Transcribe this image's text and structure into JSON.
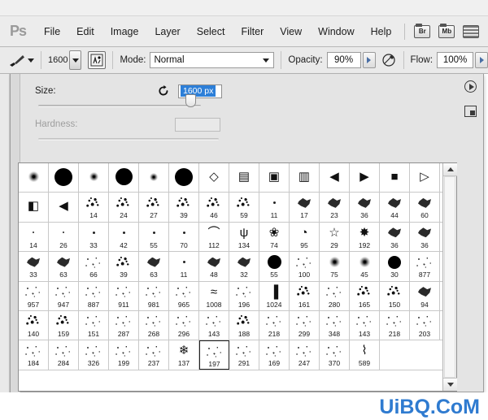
{
  "app": {
    "name": "Ps",
    "logo_text": "Ps"
  },
  "menubar": {
    "items": [
      {
        "label": "File"
      },
      {
        "label": "Edit"
      },
      {
        "label": "Image"
      },
      {
        "label": "Layer"
      },
      {
        "label": "Select"
      },
      {
        "label": "Filter"
      },
      {
        "label": "View"
      },
      {
        "label": "Window"
      },
      {
        "label": "Help"
      }
    ],
    "buttons": [
      {
        "label": "Br",
        "name": "bridge-button"
      },
      {
        "label": "Mb",
        "name": "mini-bridge-button"
      },
      {
        "label": "",
        "name": "arrange-documents-button"
      }
    ]
  },
  "options_bar": {
    "brush_size_value": "1600",
    "mode_label": "Mode:",
    "mode_value": "Normal",
    "opacity_label": "Opacity:",
    "opacity_value": "90%",
    "flow_label": "Flow:",
    "flow_value": "100%"
  },
  "picker": {
    "size_label": "Size:",
    "size_value": "1600 px",
    "hardness_label": "Hardness:",
    "hardness_value": ""
  },
  "brush_grid": {
    "selected_label": "197",
    "rows": [
      [
        {
          "label": "",
          "shape": "soft",
          "size": 13
        },
        {
          "label": "",
          "shape": "hard",
          "size": 22
        },
        {
          "label": "",
          "shape": "soft",
          "size": 11
        },
        {
          "label": "",
          "shape": "hard",
          "size": 21
        },
        {
          "label": "",
          "shape": "soft",
          "size": 10
        },
        {
          "label": "",
          "shape": "hard",
          "size": 22
        },
        {
          "label": "",
          "shape": "glyph",
          "glyph": "◇"
        },
        {
          "label": "",
          "shape": "glyph",
          "glyph": "▤"
        },
        {
          "label": "",
          "shape": "glyph",
          "glyph": "▣"
        },
        {
          "label": "",
          "shape": "glyph",
          "glyph": "▥"
        },
        {
          "label": "",
          "shape": "glyph",
          "glyph": "◀"
        },
        {
          "label": "",
          "shape": "glyph",
          "glyph": "▶"
        },
        {
          "label": "",
          "shape": "glyph",
          "glyph": "■"
        },
        {
          "label": "",
          "shape": "glyph",
          "glyph": "▷"
        }
      ],
      [
        {
          "label": "",
          "shape": "glyph",
          "glyph": "◧"
        },
        {
          "label": "",
          "shape": "glyph",
          "glyph": "◀"
        },
        {
          "label": "14",
          "shape": "spatter"
        },
        {
          "label": "24",
          "shape": "spatter"
        },
        {
          "label": "27",
          "shape": "spatter"
        },
        {
          "label": "39",
          "shape": "spatter"
        },
        {
          "label": "46",
          "shape": "spatter"
        },
        {
          "label": "59",
          "shape": "spatter"
        },
        {
          "label": "11",
          "shape": "dot"
        },
        {
          "label": "17",
          "shape": "chalk"
        },
        {
          "label": "23",
          "shape": "chalk"
        },
        {
          "label": "36",
          "shape": "chalk"
        },
        {
          "label": "44",
          "shape": "chalk"
        },
        {
          "label": "60",
          "shape": "chalk"
        }
      ],
      [
        {
          "label": "14",
          "shape": "dot",
          "size": 2
        },
        {
          "label": "26",
          "shape": "dot",
          "size": 2
        },
        {
          "label": "33",
          "shape": "dot",
          "size": 3
        },
        {
          "label": "42",
          "shape": "dot",
          "size": 3
        },
        {
          "label": "55",
          "shape": "dot",
          "size": 3
        },
        {
          "label": "70",
          "shape": "dot",
          "size": 3
        },
        {
          "label": "112",
          "shape": "glyph",
          "glyph": "⌒"
        },
        {
          "label": "134",
          "shape": "glyph",
          "glyph": "ψ"
        },
        {
          "label": "74",
          "shape": "glyph",
          "glyph": "❀"
        },
        {
          "label": "95",
          "shape": "glyph",
          "glyph": "◔"
        },
        {
          "label": "29",
          "shape": "glyph",
          "glyph": "☆"
        },
        {
          "label": "192",
          "shape": "glyph",
          "glyph": "✸"
        },
        {
          "label": "36",
          "shape": "chalk"
        },
        {
          "label": "36",
          "shape": "chalk"
        }
      ],
      [
        {
          "label": "33",
          "shape": "chalk"
        },
        {
          "label": "63",
          "shape": "chalk"
        },
        {
          "label": "66",
          "shape": "fine"
        },
        {
          "label": "39",
          "shape": "spatter"
        },
        {
          "label": "63",
          "shape": "chalk"
        },
        {
          "label": "11",
          "shape": "dot",
          "size": 3
        },
        {
          "label": "48",
          "shape": "chalk"
        },
        {
          "label": "32",
          "shape": "chalk"
        },
        {
          "label": "55",
          "shape": "hard",
          "size": 17
        },
        {
          "label": "100",
          "shape": "fine"
        },
        {
          "label": "75",
          "shape": "soft",
          "size": 13
        },
        {
          "label": "45",
          "shape": "soft",
          "size": 13
        },
        {
          "label": "30",
          "shape": "hard",
          "size": 16
        },
        {
          "label": "877",
          "shape": "fine"
        }
      ],
      [
        {
          "label": "957",
          "shape": "fine"
        },
        {
          "label": "947",
          "shape": "fine"
        },
        {
          "label": "887",
          "shape": "fine"
        },
        {
          "label": "911",
          "shape": "fine"
        },
        {
          "label": "981",
          "shape": "fine"
        },
        {
          "label": "965",
          "shape": "fine"
        },
        {
          "label": "1008",
          "shape": "glyph",
          "glyph": "≈"
        },
        {
          "label": "196",
          "shape": "fine"
        },
        {
          "label": "1024",
          "shape": "glyph",
          "glyph": "▐"
        },
        {
          "label": "161",
          "shape": "spatter"
        },
        {
          "label": "280",
          "shape": "fine"
        },
        {
          "label": "165",
          "shape": "spatter"
        },
        {
          "label": "150",
          "shape": "spatter"
        },
        {
          "label": "94",
          "shape": "chalk"
        }
      ],
      [
        {
          "label": "140",
          "shape": "spatter"
        },
        {
          "label": "159",
          "shape": "spatter"
        },
        {
          "label": "151",
          "shape": "fine"
        },
        {
          "label": "287",
          "shape": "fine"
        },
        {
          "label": "268",
          "shape": "fine"
        },
        {
          "label": "296",
          "shape": "fine"
        },
        {
          "label": "143",
          "shape": "fine"
        },
        {
          "label": "188",
          "shape": "spatter"
        },
        {
          "label": "218",
          "shape": "fine"
        },
        {
          "label": "299",
          "shape": "fine"
        },
        {
          "label": "348",
          "shape": "fine"
        },
        {
          "label": "143",
          "shape": "fine"
        },
        {
          "label": "218",
          "shape": "fine"
        },
        {
          "label": "203",
          "shape": "fine"
        }
      ],
      [
        {
          "label": "184",
          "shape": "fine"
        },
        {
          "label": "284",
          "shape": "fine"
        },
        {
          "label": "326",
          "shape": "fine"
        },
        {
          "label": "199",
          "shape": "fine"
        },
        {
          "label": "237",
          "shape": "fine"
        },
        {
          "label": "137",
          "shape": "glyph",
          "glyph": "❄"
        },
        {
          "label": "197",
          "shape": "fine",
          "selected": true
        },
        {
          "label": "291",
          "shape": "fine"
        },
        {
          "label": "169",
          "shape": "fine"
        },
        {
          "label": "247",
          "shape": "fine"
        },
        {
          "label": "370",
          "shape": "fine"
        },
        {
          "label": "589",
          "shape": "glyph",
          "glyph": "⌇"
        }
      ]
    ]
  },
  "watermark": {
    "text": "UiBQ.CoM",
    "color": "#2f7bd0"
  }
}
